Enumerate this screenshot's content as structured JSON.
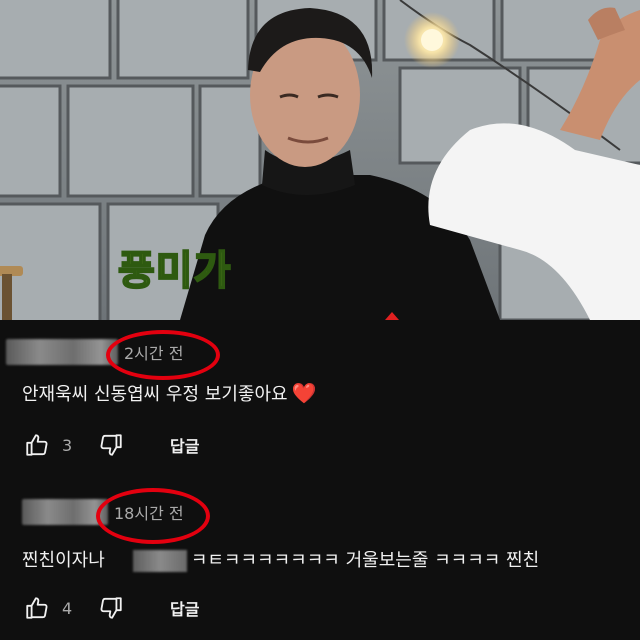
{
  "video": {
    "caption": "풍미가"
  },
  "comments": [
    {
      "author": "",
      "timestamp": "2시간 전",
      "text": "안재욱씨 신동엽씨 우정 보기좋아요",
      "emoji": "❤️",
      "likes": "3",
      "reply_label": "답글",
      "like_icon": "thumbs-up-icon",
      "dislike_icon": "thumbs-down-icon"
    },
    {
      "author": "",
      "timestamp": "18시간 전",
      "text_before": "찐친이자나",
      "text_after": "ㅋㅌㅋㅋㅋㅋㅋㅋㅋ 거울보는줄 ㅋㅋㅋㅋ 찐친",
      "likes": "4",
      "reply_label": "답글",
      "like_icon": "thumbs-up-icon",
      "dislike_icon": "thumbs-down-icon"
    }
  ],
  "colors": {
    "highlight_ring": "#e3000f",
    "caption": "#b7ef4a",
    "background": "#0f0f0f"
  }
}
